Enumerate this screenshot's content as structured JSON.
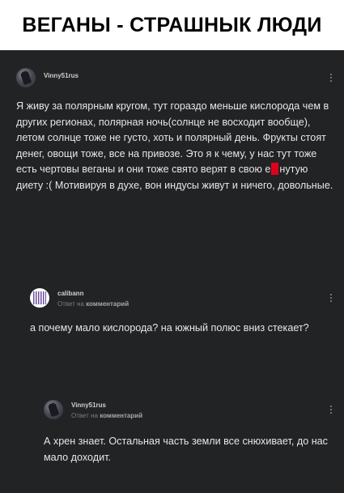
{
  "banner": {
    "title": "ВЕГАНЫ - СТРАШНЫК ЛЮДИ"
  },
  "comments": [
    {
      "author": "Vinny51rus",
      "text_before_censor": "Я живу за полярным кругом, тут гораздо меньше кислорода чем в других регионах, полярная ночь(солнце не восходит вообще), летом солнце тоже не густо, хоть и полярный день. Фрукты стоят денег, овощи тоже, все на привозе. Это я к чему, у нас тут тоже есть чертовы веганы и они тоже свято верят в свою е",
      "text_after_censor": "нутую диету :(  Мотивируя в духе, вон индусы живут и ничего, довольные.",
      "censor_color": "#e0001b",
      "avatar_icon": "dark-figure-avatar"
    },
    {
      "author": "calibann",
      "reply_prefix": "Ответ на",
      "reply_target": "комментарий",
      "text": "а почему мало кислорода? на южный полюс вниз стекает?",
      "avatar_icon": "qr-code-avatar"
    },
    {
      "author": "Vinny51rus",
      "reply_prefix": "Ответ на",
      "reply_target": "комментарий",
      "text": "А хрен знает. Остальная часть земли все снюхивает, до нас мало доходит.",
      "avatar_icon": "dark-figure-avatar"
    }
  ],
  "colors": {
    "feed_background": "#222325",
    "text": "#e6e6e6",
    "meta": "#7d7d82"
  }
}
